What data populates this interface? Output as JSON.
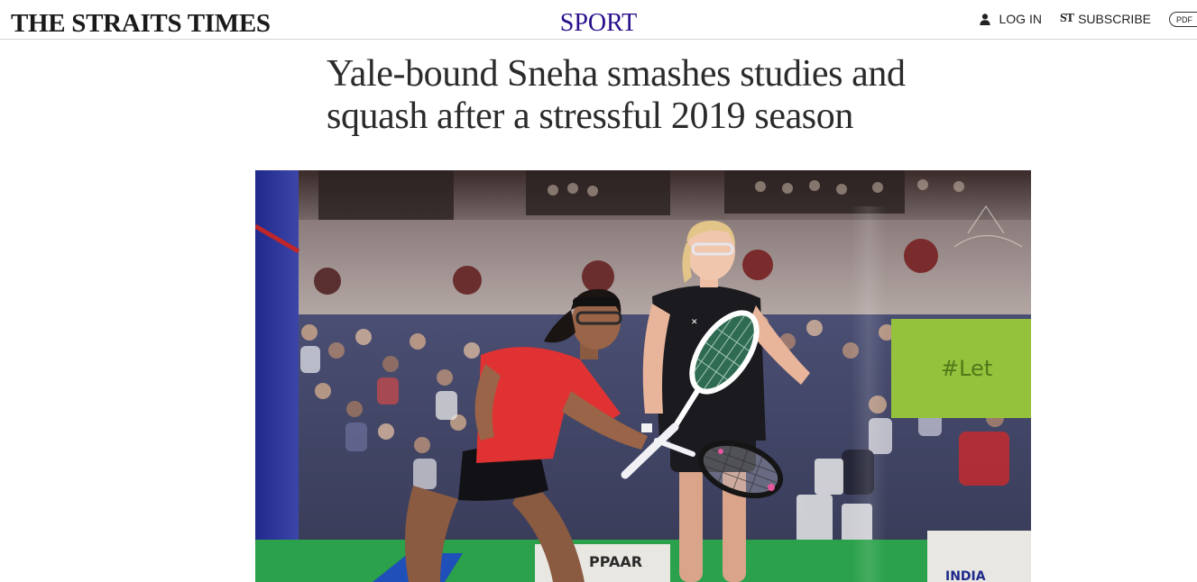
{
  "header": {
    "logo_text": "THE STRAITS TIMES",
    "section": "SPORT",
    "login_label": "LOG IN",
    "subscribe_mark": "ST",
    "subscribe_label": "SUBSCRIBE",
    "pdf_label": "PDF"
  },
  "article": {
    "headline_line1": "Yale-bound Sneha smashes studies and",
    "headline_line2": "squash after a stressful 2019 season"
  },
  "photo": {
    "banner_text": "#Let",
    "board_text": "PPAAR",
    "sponsor_text": "INDIA"
  },
  "colors": {
    "section_accent": "#2a0f8c",
    "headline": "#2b2b2b",
    "divider": "#d4d4d4"
  },
  "icons": {
    "login": "user-icon",
    "subscribe": "st-logo-icon"
  }
}
